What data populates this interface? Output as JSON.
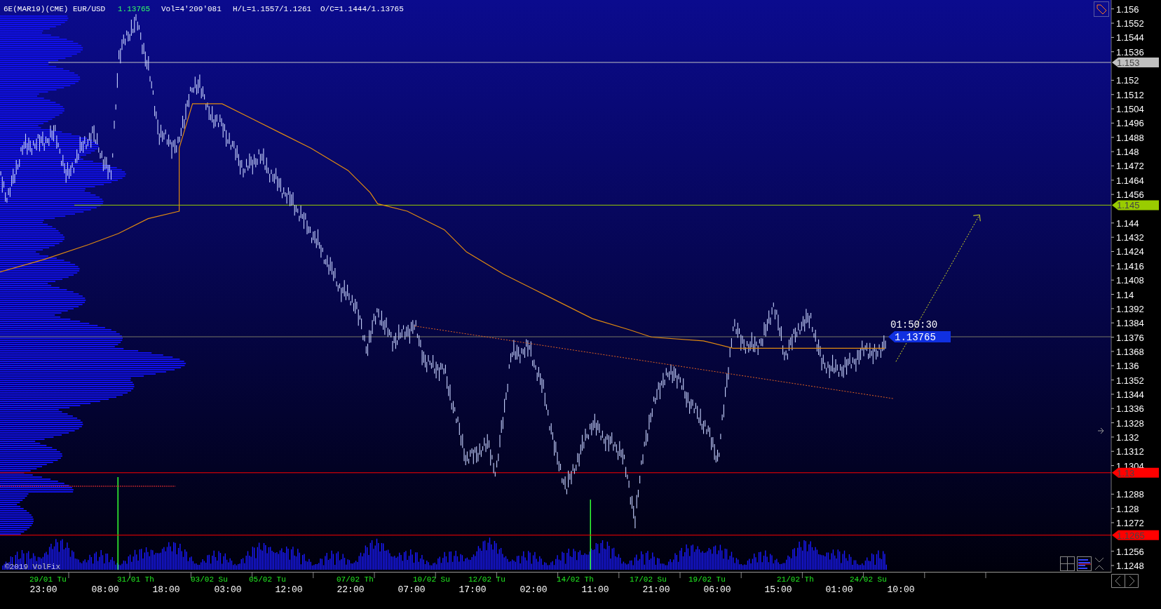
{
  "header": {
    "symbol": "6E(MAR19)(CME) EUR/USD",
    "last": "1.13765",
    "volume": "Vol=4'209'081",
    "high_low": "H/L=1.1557/1.1261",
    "open_close": "O/C=1.1444/1.13765"
  },
  "price_axis": {
    "labels": [
      "1.156",
      "1.1552",
      "1.1544",
      "1.1536",
      "1.152",
      "1.1512",
      "1.1504",
      "1.1496",
      "1.1488",
      "1.148",
      "1.1472",
      "1.1464",
      "1.1456",
      "1.144",
      "1.1432",
      "1.1424",
      "1.1416",
      "1.1408",
      "1.14",
      "1.1392",
      "1.1384",
      "1.1376",
      "1.1368",
      "1.136",
      "1.1352",
      "1.1344",
      "1.1336",
      "1.1328",
      "1.132",
      "1.1312",
      "1.1304",
      "1.1288",
      "1.128",
      "1.1272",
      "1.1256",
      "1.1248"
    ]
  },
  "levels": [
    {
      "label": "1.153",
      "color": "#c0c0c0"
    },
    {
      "label": "1.145",
      "color": "#99cc00"
    },
    {
      "label": "1.13",
      "color": "#ff0000"
    },
    {
      "label": "1.1265",
      "color": "#ff0000"
    }
  ],
  "current_price": {
    "countdown": "01:50:30",
    "price": "1.13765"
  },
  "time_axis": {
    "dates": [
      "29/01 Tu",
      "31/01 Th",
      "03/02 Su",
      "05/02 Tu",
      "07/02 Th",
      "10/02 Su",
      "12/02 Tu",
      "14/02 Th",
      "17/02 Su",
      "19/02 Tu",
      "21/02 Th",
      "24/02 Su"
    ],
    "times": [
      "23:00",
      "08:00",
      "18:00",
      "03:00",
      "12:00",
      "22:00",
      "07:00",
      "17:00",
      "02:00",
      "11:00",
      "21:00",
      "06:00",
      "15:00",
      "01:00",
      "10:00"
    ]
  },
  "copyright": "©2019 VolFix"
}
